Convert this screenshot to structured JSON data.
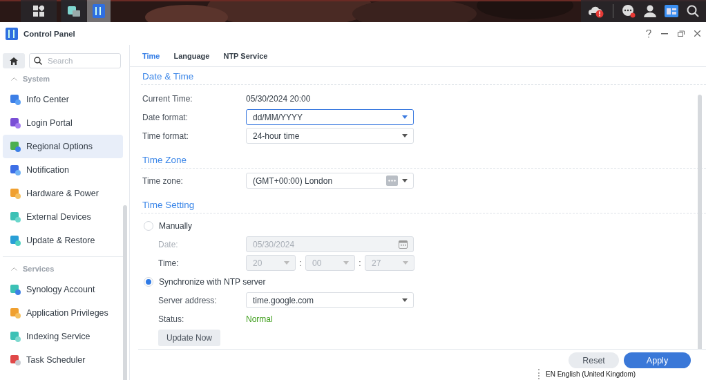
{
  "taskbar": {
    "apps": [
      {
        "selected": false
      },
      {
        "selected": true
      }
    ],
    "notifications": {
      "alert": true,
      "unread": true
    }
  },
  "window": {
    "title": "Control Panel"
  },
  "sidebar": {
    "search": {
      "placeholder": "Search"
    },
    "sections": [
      {
        "title": "System",
        "expanded": true,
        "items": [
          {
            "label": "Info Center",
            "selected": false
          },
          {
            "label": "Login Portal",
            "selected": false
          },
          {
            "label": "Regional Options",
            "selected": true
          },
          {
            "label": "Notification",
            "selected": false
          },
          {
            "label": "Hardware & Power",
            "selected": false
          },
          {
            "label": "External Devices",
            "selected": false
          },
          {
            "label": "Update & Restore",
            "selected": false
          }
        ]
      },
      {
        "title": "Services",
        "expanded": true,
        "items": [
          {
            "label": "Synology Account",
            "selected": false
          },
          {
            "label": "Application Privileges",
            "selected": false
          },
          {
            "label": "Indexing Service",
            "selected": false
          },
          {
            "label": "Task Scheduler",
            "selected": false
          }
        ]
      }
    ]
  },
  "tabs": [
    {
      "label": "Time",
      "selected": true
    },
    {
      "label": "Language",
      "selected": false
    },
    {
      "label": "NTP Service",
      "selected": false
    }
  ],
  "date_time": {
    "title": "Date & Time",
    "current_time": {
      "label": "Current Time:",
      "value": "05/30/2024 20:00"
    },
    "date_format": {
      "label": "Date format:",
      "value": "dd/MM/YYYY",
      "focused": true
    },
    "time_format": {
      "label": "Time format:",
      "value": "24-hour time",
      "focused": false
    }
  },
  "time_zone": {
    "title": "Time Zone",
    "label": "Time zone:",
    "value": "(GMT+00:00) London"
  },
  "time_setting": {
    "title": "Time Setting",
    "manually": {
      "label": "Manually",
      "selected": false,
      "disabled": true,
      "date": {
        "label": "Date:",
        "value": "05/30/2024"
      },
      "time": {
        "label": "Time:",
        "hour": "20",
        "minute": "00",
        "second": "27",
        "separators": [
          ":",
          ":"
        ]
      }
    },
    "ntp": {
      "label": "Synchronize with NTP server",
      "selected": true,
      "server": {
        "label": "Server address:",
        "value": "time.google.com"
      },
      "status": {
        "label": "Status:",
        "value": "Normal"
      },
      "update_button": "Update Now"
    }
  },
  "footer": {
    "buttons": [
      {
        "label": "Reset",
        "kind": "secondary"
      },
      {
        "label": "Apply",
        "kind": "primary"
      }
    ]
  },
  "language_bar": {
    "text": "EN English (United Kingdom)"
  }
}
